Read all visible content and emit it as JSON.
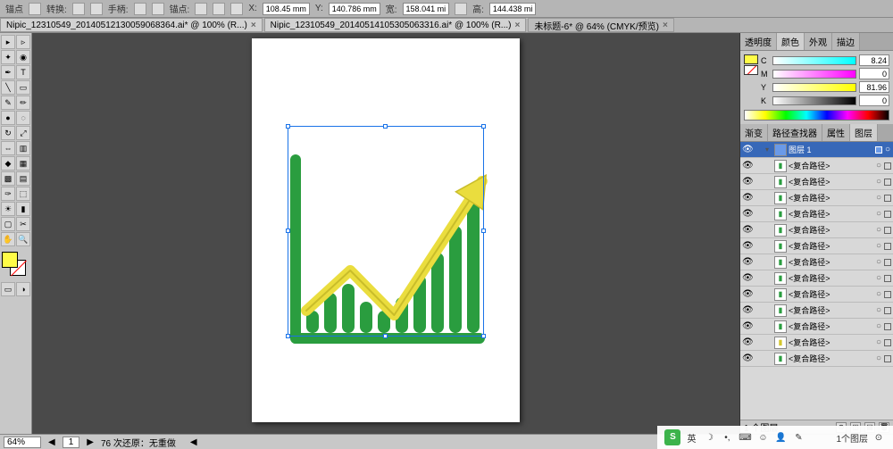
{
  "topbar": {
    "anchor_label": "锚点",
    "transform_label": "转换:",
    "handle_label": "手柄:",
    "anchor2_label": "锚点:",
    "x_label": "X:",
    "x_val": "108.45 mm",
    "y_label": "Y:",
    "y_val": "140.786 mm",
    "w_label": "宽:",
    "w_val": "158.041 mi",
    "h_label": "高:",
    "h_val": "144.438 mi"
  },
  "tabs": [
    {
      "title": "Nipic_12310549_20140512130059068364.ai* @ 100% (R...)",
      "active": false
    },
    {
      "title": "Nipic_12310549_20140514105305063316.ai* @ 100% (R...)",
      "active": false
    },
    {
      "title": "未标题-6* @ 64% (CMYK/预览)",
      "active": true
    }
  ],
  "tools": [
    [
      "select-tool",
      "▸"
    ],
    [
      "direct-select-tool",
      "▹"
    ],
    [
      "wand-tool",
      "✦"
    ],
    [
      "lasso-tool",
      "◉"
    ],
    [
      "pen-tool",
      "✒"
    ],
    [
      "type-tool",
      "T"
    ],
    [
      "line-tool",
      "╲"
    ],
    [
      "rect-tool",
      "▭"
    ],
    [
      "brush-tool",
      "✎"
    ],
    [
      "pencil-tool",
      "✏"
    ],
    [
      "blob-tool",
      "●"
    ],
    [
      "eraser-tool",
      "◌"
    ],
    [
      "rotate-tool",
      "↻"
    ],
    [
      "scale-tool",
      "⤢"
    ],
    [
      "width-tool",
      "⇔"
    ],
    [
      "free-tool",
      "▥"
    ],
    [
      "shape-tool",
      "◆"
    ],
    [
      "perspective-tool",
      "▦"
    ],
    [
      "mesh-tool",
      "▩"
    ],
    [
      "gradient-tool",
      "▤"
    ],
    [
      "eyedrop-tool",
      "✑"
    ],
    [
      "blend-tool",
      "⬚"
    ],
    [
      "symbol-tool",
      "☀"
    ],
    [
      "graph-tool",
      "▮"
    ],
    [
      "artboard-tool",
      "▢"
    ],
    [
      "slice-tool",
      "✂"
    ],
    [
      "hand-tool",
      "✋"
    ],
    [
      "zoom-tool",
      "🔍"
    ]
  ],
  "color_panel": {
    "tabs": [
      "透明度",
      "颜色",
      "外观",
      "描边"
    ],
    "active": 1,
    "sliders": [
      {
        "name": "C",
        "val": "8.24",
        "cls": "c"
      },
      {
        "name": "M",
        "val": "0",
        "cls": "m"
      },
      {
        "name": "Y",
        "val": "81.96",
        "cls": "y"
      },
      {
        "name": "K",
        "val": "0",
        "cls": "k"
      }
    ],
    "fill": "#fffc47",
    "stroke": "none"
  },
  "layers_panel": {
    "tabs": [
      "渐变",
      "路径查找器",
      "属性",
      "图层"
    ],
    "active": 3,
    "header": {
      "name": "图层 1"
    },
    "items": [
      {
        "name": "<复合路径>",
        "thumb": "g"
      },
      {
        "name": "<复合路径>",
        "thumb": "g"
      },
      {
        "name": "<复合路径>",
        "thumb": "g"
      },
      {
        "name": "<复合路径>",
        "thumb": "g"
      },
      {
        "name": "<复合路径>",
        "thumb": "g"
      },
      {
        "name": "<复合路径>",
        "thumb": "g"
      },
      {
        "name": "<复合路径>",
        "thumb": "g"
      },
      {
        "name": "<复合路径>",
        "thumb": "g"
      },
      {
        "name": "<复合路径>",
        "thumb": "g"
      },
      {
        "name": "<复合路径>",
        "thumb": "g"
      },
      {
        "name": "<复合路径>",
        "thumb": "g"
      },
      {
        "name": "<复合路径>",
        "thumb": "y"
      },
      {
        "name": "<复合路径>",
        "thumb": "g"
      }
    ],
    "footer": "1 个图层"
  },
  "status": {
    "zoom": "64%",
    "page": "1",
    "undo": "76 次还原：无重做"
  },
  "taskbar": {
    "ime": "英",
    "layers_text": "1个图层"
  },
  "chart_data": {
    "type": "bar",
    "description": "Vector artwork of a rising bar chart with trend arrow (icon design, not real data)",
    "bars": [
      25,
      45,
      55,
      35,
      25,
      40,
      65,
      90,
      120,
      150
    ],
    "arrow_points": [
      [
        0,
        25
      ],
      [
        60,
        70
      ],
      [
        120,
        20
      ],
      [
        240,
        170
      ]
    ],
    "colors": {
      "bars": "#2a9d3f",
      "axis": "#2a9d3f",
      "arrow_fill": "#eadd3e",
      "arrow_stroke": "#c9bd2a"
    },
    "axis_thickness": 12
  }
}
